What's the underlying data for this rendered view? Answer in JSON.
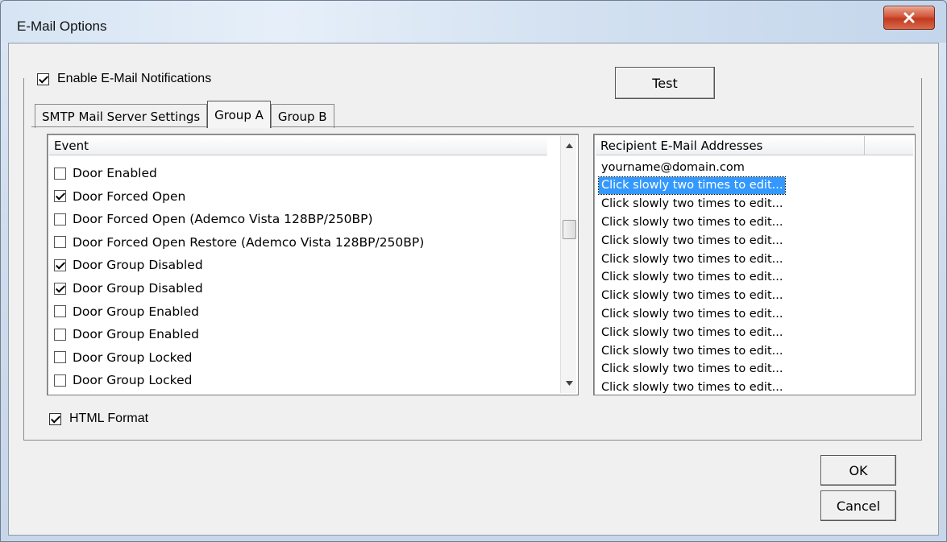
{
  "window": {
    "title": "E-Mail Options"
  },
  "enable_notifications": {
    "label": "Enable E-Mail Notifications",
    "checked": true
  },
  "buttons": {
    "test": "Test",
    "ok": "OK",
    "cancel": "Cancel"
  },
  "tabs": [
    {
      "label": "SMTP Mail Server Settings",
      "active": false
    },
    {
      "label": "Group A",
      "active": true
    },
    {
      "label": "Group B",
      "active": false
    }
  ],
  "event_list": {
    "header": "Event",
    "items": [
      {
        "label": "Door Enabled",
        "checked": false
      },
      {
        "label": "Door Forced Open",
        "checked": true
      },
      {
        "label": "Door Forced Open (Ademco Vista 128BP/250BP)",
        "checked": false
      },
      {
        "label": "Door Forced Open Restore (Ademco Vista 128BP/250BP)",
        "checked": false
      },
      {
        "label": "Door Group Disabled",
        "checked": true
      },
      {
        "label": "Door Group Disabled",
        "checked": true
      },
      {
        "label": "Door Group Enabled",
        "checked": false
      },
      {
        "label": "Door Group Enabled",
        "checked": false
      },
      {
        "label": "Door Group Locked",
        "checked": false
      },
      {
        "label": "Door Group Locked",
        "checked": false
      }
    ]
  },
  "recipients": {
    "header": "Recipient E-Mail Addresses",
    "items": [
      {
        "label": "yourname@domain.com",
        "selected": false
      },
      {
        "label": "Click slowly two times to edit...",
        "selected": true
      },
      {
        "label": "Click slowly two times to edit...",
        "selected": false
      },
      {
        "label": "Click slowly two times to edit...",
        "selected": false
      },
      {
        "label": "Click slowly two times to edit...",
        "selected": false
      },
      {
        "label": "Click slowly two times to edit...",
        "selected": false
      },
      {
        "label": "Click slowly two times to edit...",
        "selected": false
      },
      {
        "label": "Click slowly two times to edit...",
        "selected": false
      },
      {
        "label": "Click slowly two times to edit...",
        "selected": false
      },
      {
        "label": "Click slowly two times to edit...",
        "selected": false
      },
      {
        "label": "Click slowly two times to edit...",
        "selected": false
      },
      {
        "label": "Click slowly two times to edit...",
        "selected": false
      },
      {
        "label": "Click slowly two times to edit...",
        "selected": false
      }
    ]
  },
  "html_format": {
    "label": "HTML Format",
    "checked": true
  },
  "colors": {
    "selection": "#3399ff",
    "close_button": "#c23a1f"
  }
}
